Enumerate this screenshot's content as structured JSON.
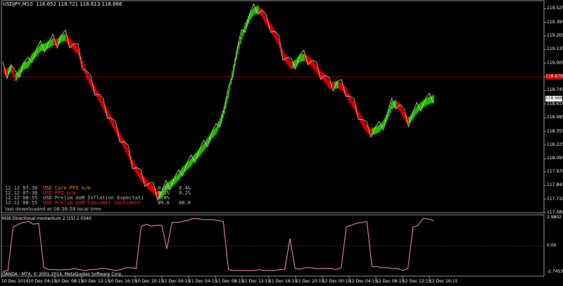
{
  "window": {
    "title": "USDJPY,M10  118.652 118.721 118.613 118.666"
  },
  "price_axis": {
    "ticks": [
      "119.525",
      "119.395",
      "119.265",
      "119.135",
      "119.005",
      "118.875",
      "118.745",
      "118.615",
      "118.485",
      "118.355",
      "118.225",
      "118.095",
      "117.970",
      "117.840",
      "117.710",
      "117.580"
    ],
    "hline_tag": "118.875",
    "current_tag": "118.666",
    "hline_color": "#cc0000",
    "current_tag_color": "#ffffff"
  },
  "news_panel": {
    "rows": [
      {
        "time": "12.12 07:30",
        "event": "USD Core PPI m/m",
        "actual": "0.1%",
        "forecast": "0.4%",
        "event_color": "#ff8c00",
        "value_color": "#c0c0c0"
      },
      {
        "time": "12.12 07:30",
        "event": "USD PPI m/m",
        "actual": "-0.1%",
        "forecast": "0.2%",
        "event_color": "#ff3030",
        "value_color": "#c0c0c0"
      },
      {
        "time": "12.12 08:55",
        "event": "USD Prelim UoM Inflation Expectati",
        "actual": "2.8%",
        "forecast": "",
        "event_color": "#c0c0c0",
        "value_color": "#c0c0c0"
      },
      {
        "time": "12.12 08:55",
        "event": "USD Prelim UoM Consumer Sentiment",
        "actual": "89.6",
        "forecast": "88.8",
        "event_color": "#ff3030",
        "value_color": "#c0c0c0"
      }
    ],
    "status": "last downloaded at 08:38:58 local time"
  },
  "indicator": {
    "label": "M36 Directional momentum 2 (15) 2.0540",
    "ticks": [
      "2.9802",
      "0.00",
      "-2.7453"
    ],
    "line_color": "#ff9ec4"
  },
  "footer": {
    "copyright": "OANDA - MT4, © 2001-2014, MetaQuotes Software Corp."
  },
  "time_axis": {
    "labels": [
      "10 Dec 2014",
      "10 Dec 04:15",
      "10 Dec 08:15",
      "10 Dec 12:15",
      "10 Dec 16:15",
      "10 Dec 20:15",
      "11 Dec 00:15",
      "11 Dec 04:15",
      "11 Dec 08:15",
      "11 Dec 12:15",
      "11 Dec 16:15",
      "11 Dec 20:15",
      "12 Dec 00:15",
      "12 Dec 04:15",
      "12 Dec 08:15",
      "12 Dec 12:15",
      "12 Dec 16:15"
    ]
  },
  "chart_data": {
    "type": "line",
    "symbol": "USDJPY",
    "timeframe": "M10",
    "ylim": [
      117.58,
      119.6
    ],
    "price_close": [
      118.95,
      118.91,
      118.96,
      118.86,
      118.92,
      118.98,
      118.99,
      119.06,
      119.1,
      119.15,
      119.16,
      119.18,
      119.21,
      119.2,
      119.24,
      119.25,
      119.2,
      119.16,
      119.12,
      119.0,
      118.9,
      118.82,
      118.75,
      118.68,
      118.6,
      118.53,
      118.45,
      118.38,
      118.3,
      118.23,
      118.15,
      118.05,
      117.98,
      117.92,
      117.88,
      117.83,
      117.8,
      117.75,
      117.75,
      117.82,
      117.85,
      117.88,
      117.92,
      117.98,
      118.02,
      118.06,
      118.11,
      118.15,
      118.2,
      118.26,
      118.32,
      118.36,
      118.45,
      118.56,
      118.72,
      118.92,
      119.1,
      119.25,
      119.35,
      119.44,
      119.5,
      119.52,
      119.48,
      119.4,
      119.35,
      119.28,
      119.2,
      119.08,
      119.03,
      118.98,
      119.0,
      119.05,
      119.06,
      119.04,
      119.0,
      118.95,
      118.9,
      118.86,
      118.8,
      118.79,
      118.8,
      118.78,
      118.74,
      118.66,
      118.6,
      118.52,
      118.44,
      118.38,
      118.35,
      118.36,
      118.38,
      118.42,
      118.5,
      118.6,
      118.62,
      118.58,
      118.5,
      118.45,
      118.5,
      118.56,
      118.6,
      118.63,
      118.65,
      118.666
    ],
    "trend_line_colors": [
      "#ff0000",
      "#33dd00"
    ],
    "indicator_ylim": [
      -3.2,
      3.3
    ],
    "indicator_values": [
      -2.7,
      -2.6,
      2.0,
      2.3,
      2.5,
      2.6,
      2.3,
      2.4,
      -2.3,
      -2.5,
      -2.5,
      -2.55,
      -2.5,
      -2.5,
      -2.4,
      -2.5,
      -2.6,
      -2.5,
      -2.5,
      -2.4,
      -2.4,
      -2.5,
      -2.6,
      -2.5,
      -2.3,
      -2.3,
      -2.4,
      2.1,
      2.3,
      2.1,
      2.2,
      2.2,
      -0.3,
      2.5,
      2.5,
      2.6,
      2.7,
      2.9,
      2.9,
      2.8,
      2.8,
      2.8,
      2.7,
      2.6,
      -2.5,
      -2.6,
      -2.6,
      -2.6,
      -2.6,
      -2.6,
      -2.5,
      -2.6,
      -2.6,
      -2.6,
      -2.5,
      -2.5,
      0.8,
      -2.4,
      -2.45,
      -2.3,
      -2.3,
      -2.4,
      -2.4,
      -2.4,
      -2.4,
      -2.5,
      -2.3,
      2.0,
      2.2,
      2.4,
      2.5,
      2.6,
      -2.2,
      -2.2,
      -2.3,
      -2.3,
      -2.4,
      -2.4,
      -2.6,
      -2.4,
      2.0,
      2.2,
      2.9,
      2.85,
      2.7
    ]
  }
}
